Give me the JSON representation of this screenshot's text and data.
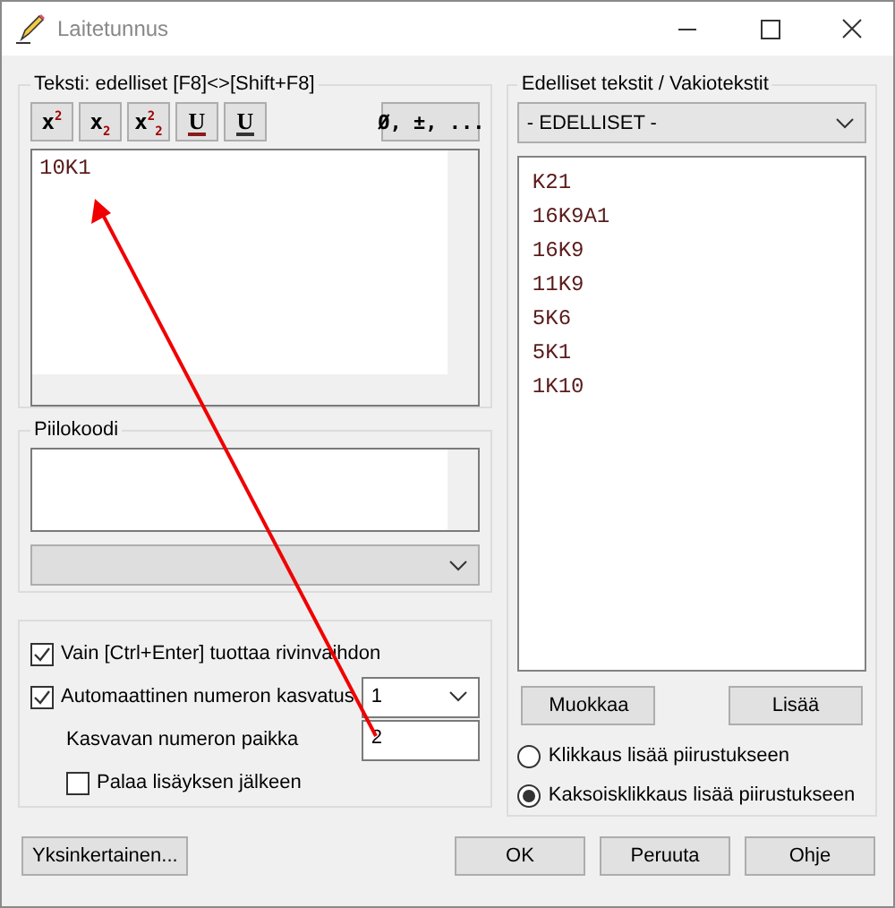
{
  "window": {
    "title": "Laitetunnus"
  },
  "text_group": {
    "title": "Teksti:  edelliset [F8]<>[Shift+F8]",
    "value": "10K1",
    "toolbar": [
      {
        "kind": "format",
        "label": "x$^{2}$"
      },
      {
        "kind": "format",
        "label": "x$_{2}$"
      },
      {
        "kind": "format",
        "label": "x$^{2}$$_{2}$"
      },
      {
        "kind": "underline",
        "label": "U",
        "color": "#8b1a1a"
      },
      {
        "kind": "underline",
        "label": "U",
        "color": "#333333"
      },
      {
        "kind": "symbols",
        "label": "Ø, ±, ..."
      }
    ]
  },
  "hidden_code_group": {
    "title": "Piilokoodi"
  },
  "options": [
    {
      "kind": "checkbox",
      "label": "Vain [Ctrl+Enter] tuottaa rivinvaihdon",
      "checked": true
    },
    {
      "kind": "checkbox-dropdown",
      "label": "Automaattinen numeron kasvatus",
      "checked": true,
      "value": "1"
    },
    {
      "kind": "field",
      "label": "Kasvavan numeron paikka",
      "value": "2"
    },
    {
      "kind": "sub-checkbox",
      "label": "Palaa lisäyksen jälkeen",
      "checked": false
    }
  ],
  "library": {
    "title": "Edelliset tekstit / Vakiotekstit",
    "dropdown": "- EDELLISET -",
    "items": [
      "K21",
      "16K9A1",
      "16K9",
      "11K9",
      "5K6",
      "5K1",
      "1K10"
    ],
    "buttons": [
      "Muokkaa",
      "Lisää"
    ],
    "radios": [
      {
        "label": "Klikkaus lisää piirustukseen",
        "selected": false
      },
      {
        "label": "Kaksoisklikkaus lisää piirustukseen",
        "selected": true
      }
    ]
  },
  "footer": {
    "left_button": "Yksinkertainen...",
    "buttons": [
      "OK",
      "Peruuta",
      "Ohje"
    ]
  }
}
